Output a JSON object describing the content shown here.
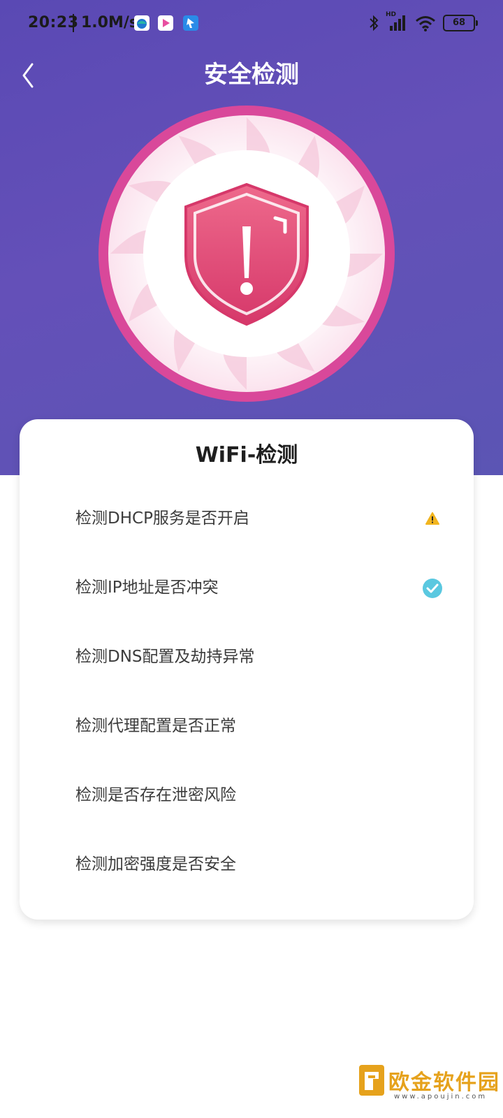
{
  "status_bar": {
    "time": "20:23",
    "speed": "1.0M/s",
    "hd_label": "HD",
    "battery": "68"
  },
  "header": {
    "title": "安全检测"
  },
  "card": {
    "title": "WiFi-检测",
    "items": [
      {
        "label": "检测DHCP服务是否开启",
        "status": "warning"
      },
      {
        "label": "检测IP地址是否冲突",
        "status": "passed"
      },
      {
        "label": "检测DNS配置及劫持异常",
        "status": "pending"
      },
      {
        "label": "检测代理配置是否正常",
        "status": "pending"
      },
      {
        "label": "检测是否存在泄密风险",
        "status": "pending"
      },
      {
        "label": "检测加密强度是否安全",
        "status": "pending"
      }
    ]
  },
  "watermark": {
    "text": "欧金软件园",
    "url": "www.apoujin.com"
  },
  "colors": {
    "hero_bg": "#5d4cb6",
    "ring_pink": "#d9489a",
    "shield_red": "#e0466e",
    "warning_yellow": "#f2b51f",
    "success_cyan": "#5ac8e0"
  }
}
